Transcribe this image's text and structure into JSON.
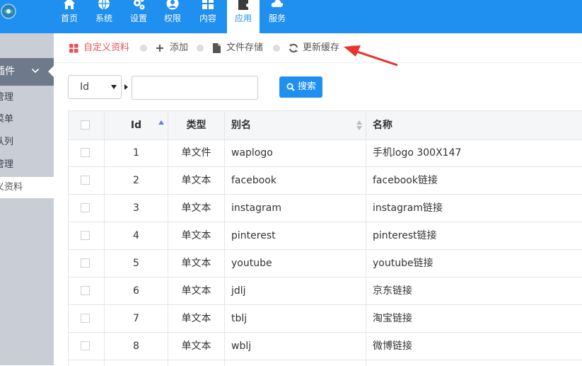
{
  "nav": {
    "items": [
      {
        "label": "首页",
        "icon": "home-icon"
      },
      {
        "label": "系统",
        "icon": "globe-icon"
      },
      {
        "label": "设置",
        "icon": "gears-icon"
      },
      {
        "label": "权限",
        "icon": "user-icon"
      },
      {
        "label": "内容",
        "icon": "grid-icon"
      },
      {
        "label": "应用",
        "icon": "puzzle-icon",
        "active": true
      },
      {
        "label": "服务",
        "icon": "cloud-icon"
      }
    ]
  },
  "sidebar": {
    "group_label": "插件",
    "items": [
      {
        "label": "管理"
      },
      {
        "label": "菜单"
      },
      {
        "label": "队列"
      },
      {
        "label": "管理"
      },
      {
        "label": "义资料",
        "active": true
      }
    ]
  },
  "toolbar": {
    "custom_data": "自定义资料",
    "add": "添加",
    "file_storage": "文件存储",
    "refresh_cache": "更新缓存"
  },
  "search": {
    "field_selected": "Id",
    "query_value": "",
    "button_label": "搜索"
  },
  "table": {
    "headers": {
      "id": "Id",
      "type": "类型",
      "alias": "别名",
      "name": "名称"
    },
    "rows": [
      {
        "id": "1",
        "type": "单文件",
        "alias": "waplogo",
        "name": "手机logo 300X147"
      },
      {
        "id": "2",
        "type": "单文本",
        "alias": "facebook",
        "name": "facebook链接"
      },
      {
        "id": "3",
        "type": "单文本",
        "alias": "instagram",
        "name": "instagram链接"
      },
      {
        "id": "4",
        "type": "单文本",
        "alias": "pinterest",
        "name": "pinterest链接"
      },
      {
        "id": "5",
        "type": "单文本",
        "alias": "youtube",
        "name": "youtube链接"
      },
      {
        "id": "6",
        "type": "单文本",
        "alias": "jdlj",
        "name": "京东链接"
      },
      {
        "id": "7",
        "type": "单文本",
        "alias": "tblj",
        "name": "淘宝链接"
      },
      {
        "id": "8",
        "type": "单文本",
        "alias": "wblj",
        "name": "微博链接"
      }
    ]
  },
  "colors": {
    "primary": "#1f8ff0",
    "sidebar_bg": "#c9ced6",
    "sidebar_group": "#6e7a8a",
    "annotation_arrow": "#e8332e"
  }
}
